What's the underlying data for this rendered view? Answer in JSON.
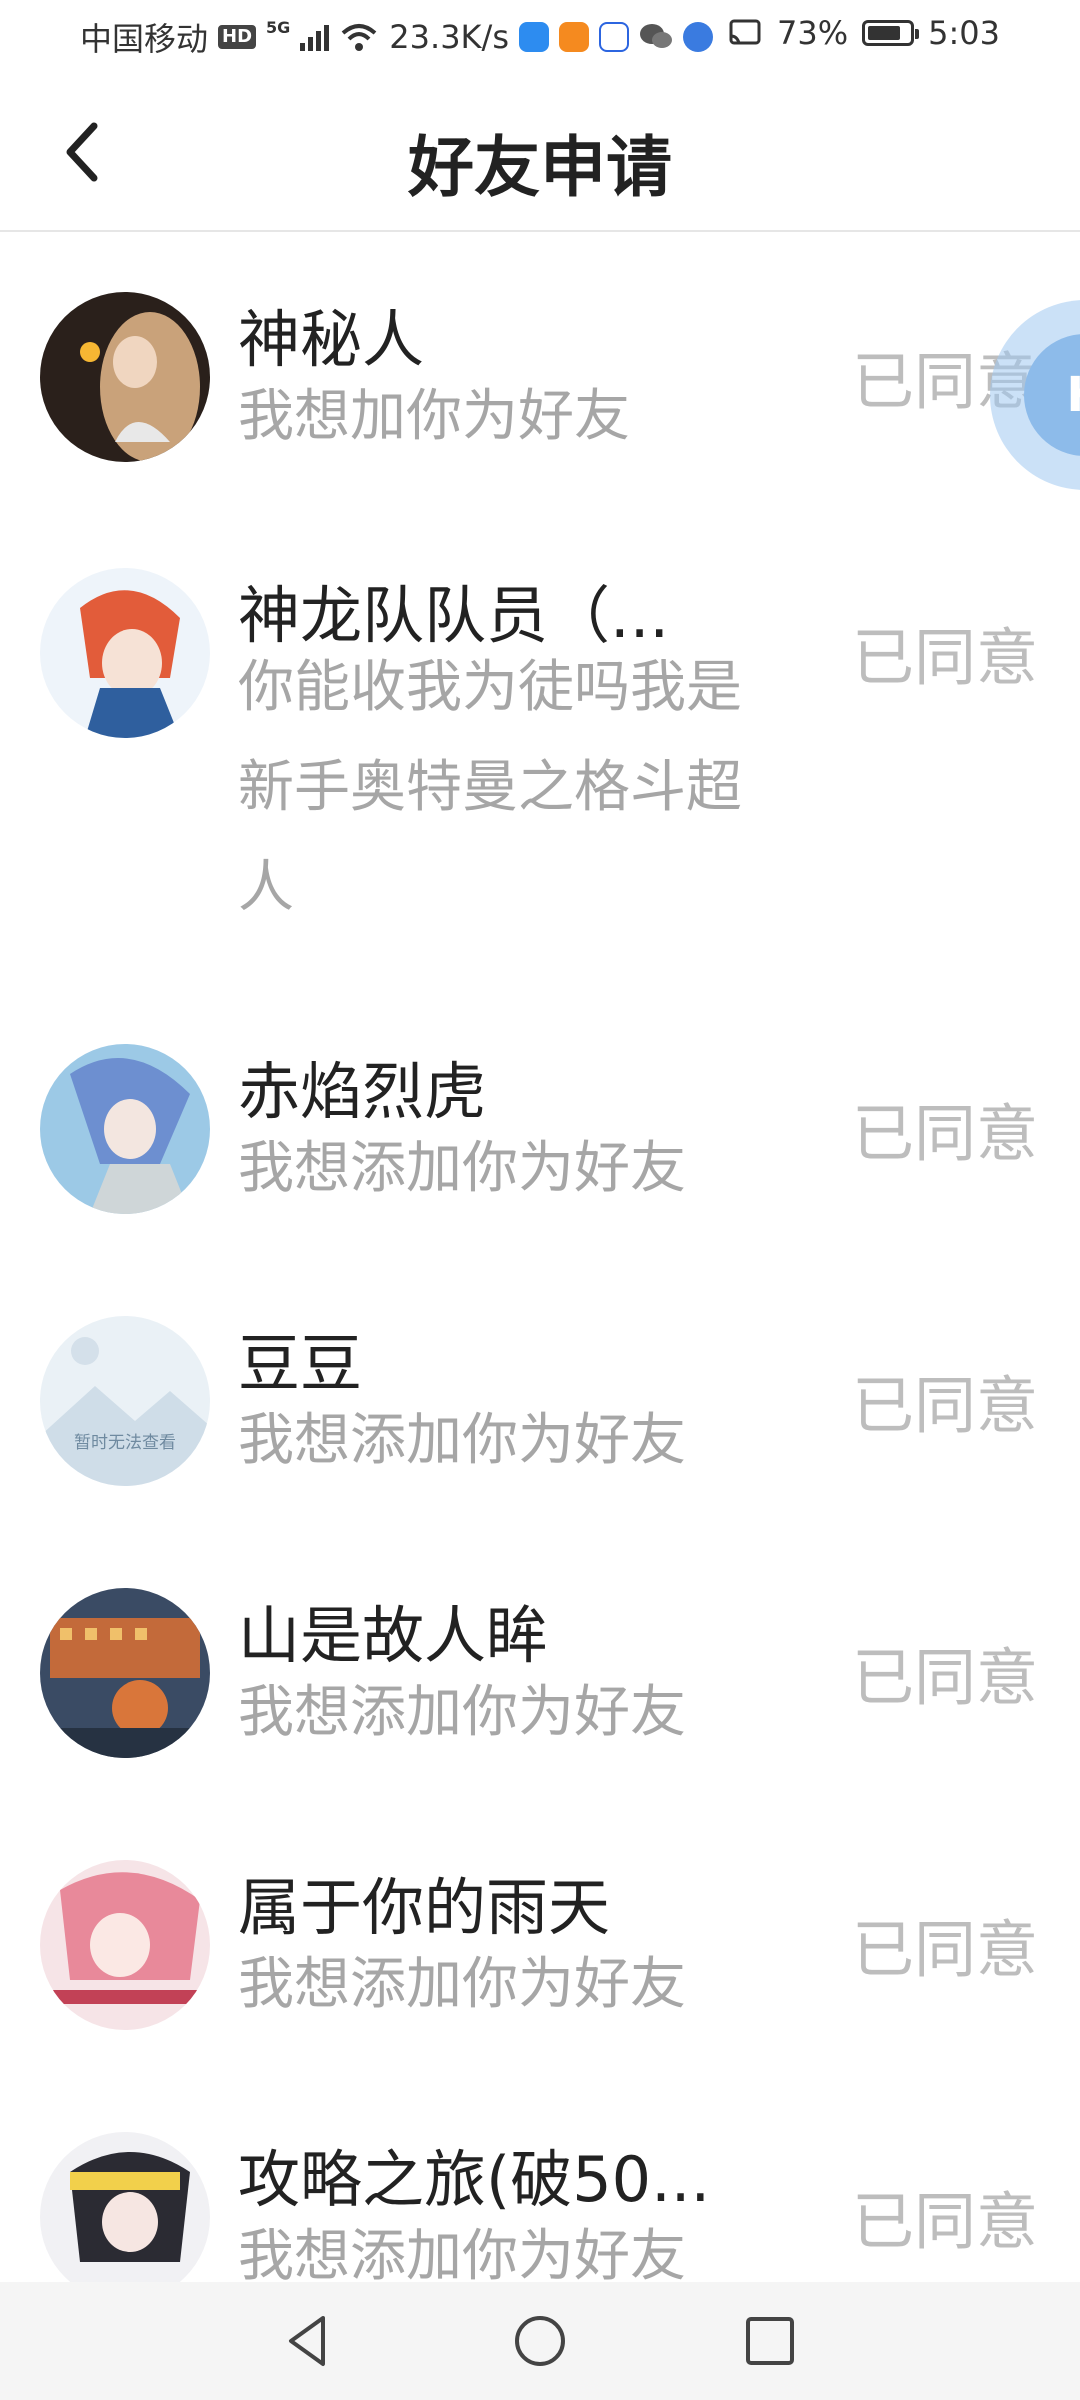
{
  "status_bar": {
    "carrier": "中国移动",
    "hd": "HD",
    "network": "5G",
    "speed": "23.3K/s",
    "battery_percent": "73%",
    "time": "5:03"
  },
  "header": {
    "title": "好友申请"
  },
  "requests": [
    {
      "name": "神秘人",
      "message": "我想加你为好友",
      "status": "已同意",
      "avatar_colors": [
        "#3b2a20",
        "#c9a27a"
      ]
    },
    {
      "name": "神龙队队员（...",
      "message": "你能收我为徒吗我是新手奥特曼之格斗超人",
      "status": "已同意",
      "avatar_colors": [
        "#d8e6f2",
        "#e25c3a"
      ]
    },
    {
      "name": "赤焰烈虎",
      "message": "我想添加你为好友",
      "status": "已同意",
      "avatar_colors": [
        "#9cc9e6",
        "#d9e4ea"
      ]
    },
    {
      "name": "豆豆",
      "message": "我想添加你为好友",
      "status": "已同意",
      "avatar_caption": "暂时无法查看",
      "avatar_colors": [
        "#eaf1f6",
        "#c6d6e2"
      ]
    },
    {
      "name": "山是故人眸",
      "message": "我想添加你为好友",
      "status": "已同意",
      "avatar_colors": [
        "#3a4b64",
        "#d9763a"
      ]
    },
    {
      "name": "属于你的雨天",
      "message": "我想添加你为好友",
      "status": "已同意",
      "avatar_colors": [
        "#f3c9cf",
        "#d8606f"
      ]
    },
    {
      "name": "攻略之旅(破50...",
      "message": "我想添加你为好友",
      "status": "已同意",
      "avatar_colors": [
        "#2b2b33",
        "#f2d04b"
      ]
    }
  ],
  "colors": {
    "status_text": "#bdbdbd",
    "message_text": "#a6a6a6",
    "name_text": "#222222",
    "accent_float": "#8dbbea"
  },
  "icons": {
    "back": "chevron-left-icon",
    "nav_back": "triangle-back-icon",
    "nav_home": "circle-home-icon",
    "nav_recent": "square-recent-icon"
  }
}
